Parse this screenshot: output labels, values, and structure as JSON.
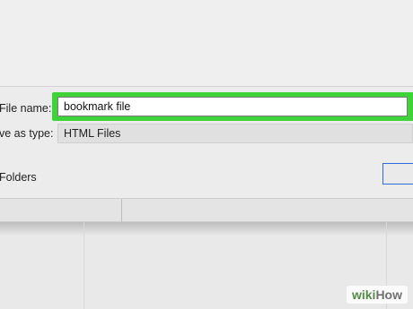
{
  "dialog": {
    "file_name_label": "File name:",
    "file_name_value": "bookmark file",
    "save_as_type_label": "ve as type:",
    "save_as_type_value": "HTML Files",
    "hide_folders_label": "Folders"
  },
  "watermark": {
    "part1": "wiki",
    "part2": "How"
  },
  "colors": {
    "highlight": "#3fd33a",
    "focus_border": "#2f6bd8"
  }
}
